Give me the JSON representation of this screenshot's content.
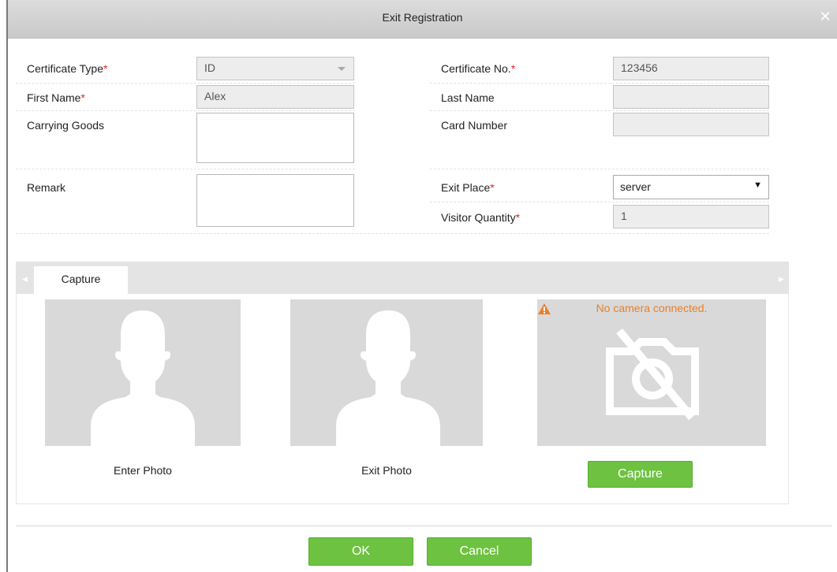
{
  "dialog": {
    "title": "Exit Registration"
  },
  "form": {
    "certificate_type": {
      "label": "Certificate Type",
      "value": "ID"
    },
    "certificate_no": {
      "label": "Certificate No.",
      "value": "123456"
    },
    "first_name": {
      "label": "First Name",
      "value": "Alex"
    },
    "last_name": {
      "label": "Last Name",
      "value": ""
    },
    "carrying_goods": {
      "label": "Carrying Goods",
      "value": ""
    },
    "card_number": {
      "label": "Card Number",
      "value": ""
    },
    "remark": {
      "label": "Remark",
      "value": ""
    },
    "exit_place": {
      "label": "Exit Place",
      "value": "server"
    },
    "visitor_quantity": {
      "label": "Visitor Quantity",
      "value": "1"
    },
    "required_mark": "*"
  },
  "capture": {
    "tab_label": "Capture",
    "enter_photo_label": "Enter Photo",
    "exit_photo_label": "Exit Photo",
    "camera_message": "No camera connected.",
    "capture_button": "Capture"
  },
  "footer": {
    "ok_label": "OK",
    "cancel_label": "Cancel"
  },
  "icons": {
    "close": "close-icon",
    "warning": "warning-icon",
    "no_camera": "camera-off-icon",
    "avatar": "person-silhouette-icon",
    "dropdown": "chevron-down-icon"
  },
  "colors": {
    "accent_green": "#6ec242",
    "required_red": "#e02424",
    "warning_orange": "#e8802a",
    "titlebar": "#d3d3d3",
    "photo_bg": "#d9d9d9"
  }
}
